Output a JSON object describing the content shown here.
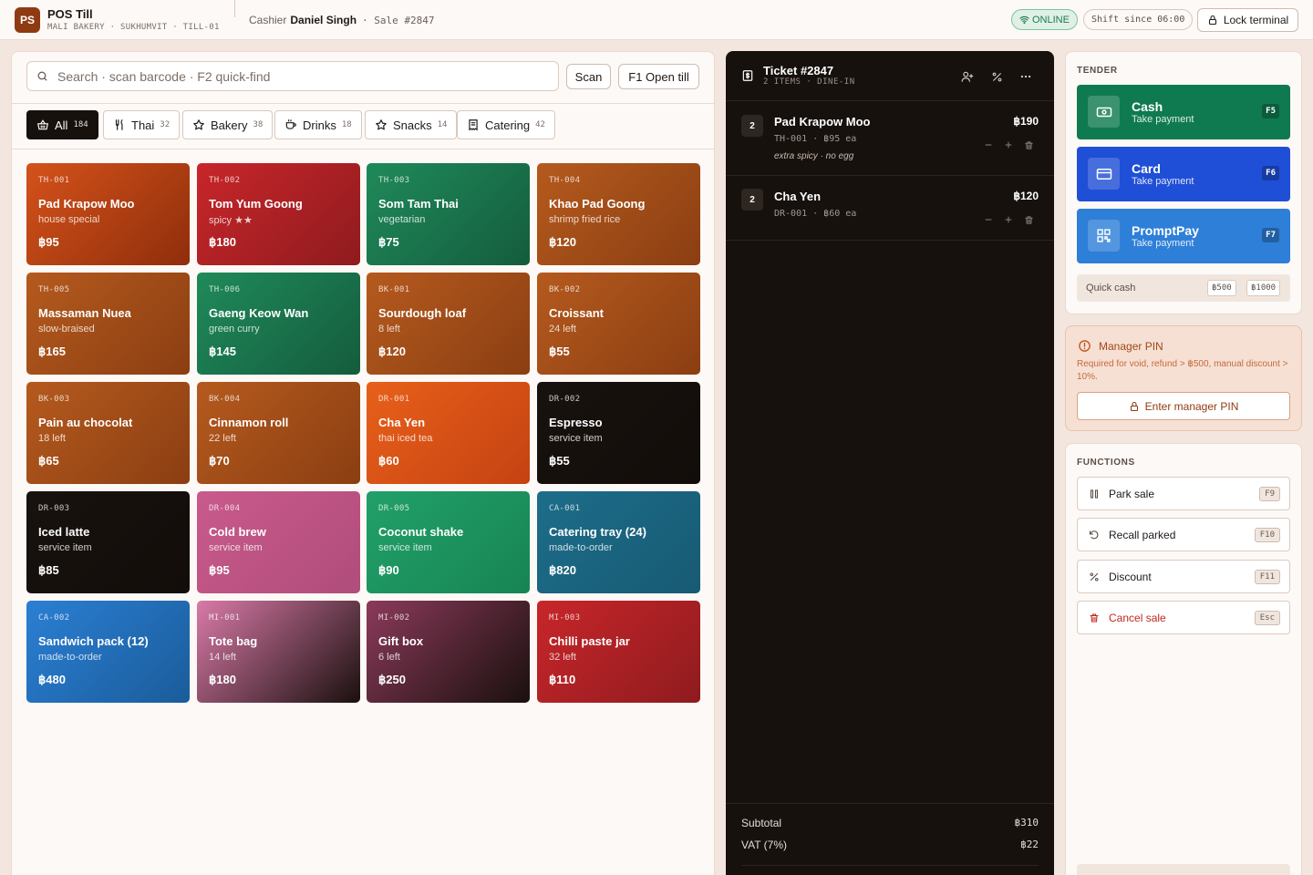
{
  "header": {
    "logo": "PS",
    "title": "POS Till",
    "subtitle": "MALI BAKERY · SUKHUMVIT · TILL-01",
    "cashier_label": "Cashier",
    "cashier_name": "Daniel Singh",
    "sale": "· Sale #2847",
    "status": "ONLINE",
    "shift": "Shift since 06:00",
    "lock_label": "Lock terminal"
  },
  "search": {
    "placeholder": "Search · scan barcode · F2 quick-find",
    "value": "",
    "scan_label": "Scan",
    "open_till_label": "F1 Open till"
  },
  "categories": [
    {
      "label": "All",
      "count": "184",
      "icon": "basket-icon",
      "active": true
    },
    {
      "label": "Thai",
      "count": "32",
      "icon": "utensils-icon"
    },
    {
      "label": "Bakery",
      "count": "38",
      "icon": "star-icon"
    },
    {
      "label": "Drinks",
      "count": "18",
      "icon": "cup-icon"
    },
    {
      "label": "Snacks",
      "count": "14",
      "icon": "star-icon"
    },
    {
      "label": "Catering",
      "count": "42",
      "icon": "receipt-icon"
    }
  ],
  "products": [
    {
      "sku": "TH-001",
      "name": "Pad Krapow Moo",
      "sub": "house special",
      "price": "฿95",
      "colors": [
        "#d4521a",
        "#8f2e0c"
      ]
    },
    {
      "sku": "TH-002",
      "name": "Tom Yum Goong",
      "sub": "spicy ★★",
      "price": "฿180",
      "colors": [
        "#c8262a",
        "#8e1b1e"
      ]
    },
    {
      "sku": "TH-003",
      "name": "Som Tam Thai",
      "sub": "vegetarian",
      "price": "฿75",
      "colors": [
        "#1f8a5a",
        "#145c3d"
      ]
    },
    {
      "sku": "TH-004",
      "name": "Khao Pad Goong",
      "sub": "shrimp fried rice",
      "price": "฿120",
      "colors": [
        "#b55a1e",
        "#8b3e12"
      ]
    },
    {
      "sku": "TH-005",
      "name": "Massaman Nuea",
      "sub": "slow-braised",
      "price": "฿165",
      "colors": [
        "#b55a1e",
        "#8b3e12"
      ]
    },
    {
      "sku": "TH-006",
      "name": "Gaeng Keow Wan",
      "sub": "green curry",
      "price": "฿145",
      "colors": [
        "#1f8a5a",
        "#145c3d"
      ]
    },
    {
      "sku": "BK-001",
      "name": "Sourdough loaf",
      "sub": "8 left",
      "price": "฿120",
      "colors": [
        "#b55a1e",
        "#8b3e12"
      ]
    },
    {
      "sku": "BK-002",
      "name": "Croissant",
      "sub": "24 left",
      "price": "฿55",
      "colors": [
        "#b55a1e",
        "#8b3e12"
      ]
    },
    {
      "sku": "BK-003",
      "name": "Pain au chocolat",
      "sub": "18 left",
      "price": "฿65",
      "colors": [
        "#b55a1e",
        "#8b3e12"
      ]
    },
    {
      "sku": "BK-004",
      "name": "Cinnamon roll",
      "sub": "22 left",
      "price": "฿70",
      "colors": [
        "#b55a1e",
        "#8b3e12"
      ]
    },
    {
      "sku": "DR-001",
      "name": "Cha Yen",
      "sub": "thai iced tea",
      "price": "฿60",
      "colors": [
        "#e8601a",
        "#c54212"
      ]
    },
    {
      "sku": "DR-002",
      "name": "Espresso",
      "sub": "service item",
      "price": "฿55",
      "colors": [
        "#18120e",
        "#120d0a"
      ]
    },
    {
      "sku": "DR-003",
      "name": "Iced latte",
      "sub": "service item",
      "price": "฿85",
      "colors": [
        "#18120e",
        "#120d0a"
      ]
    },
    {
      "sku": "DR-004",
      "name": "Cold brew",
      "sub": "service item",
      "price": "฿95",
      "colors": [
        "#c95a8c",
        "#b04d7a"
      ]
    },
    {
      "sku": "DR-005",
      "name": "Coconut shake",
      "sub": "service item",
      "price": "฿90",
      "colors": [
        "#22a06a",
        "#178553"
      ]
    },
    {
      "sku": "CA-001",
      "name": "Catering tray (24)",
      "sub": "made-to-order",
      "price": "฿820",
      "colors": [
        "#1d6d8a",
        "#175a73"
      ]
    },
    {
      "sku": "CA-002",
      "name": "Sandwich pack (12)",
      "sub": "made-to-order",
      "price": "฿480",
      "colors": [
        "#2b7fd4",
        "#1a5c9a"
      ]
    },
    {
      "sku": "MI-001",
      "name": "Tote bag",
      "sub": "14 left",
      "price": "฿180",
      "colors": [
        "#d97aa8",
        "#1a100e"
      ]
    },
    {
      "sku": "MI-002",
      "name": "Gift box",
      "sub": "6 left",
      "price": "฿250",
      "colors": [
        "#8b3a5a",
        "#1a100e"
      ]
    },
    {
      "sku": "MI-003",
      "name": "Chilli paste jar",
      "sub": "32 left",
      "price": "฿110",
      "colors": [
        "#c8262a",
        "#8e1b1e"
      ]
    }
  ],
  "ticket": {
    "title": "Ticket #2847",
    "subtitle": "2 ITEMS · DINE-IN",
    "lines": [
      {
        "qty": "2",
        "name": "Pad Krapow Moo",
        "meta": "TH-001  ·  ฿95 ea",
        "note": "extra spicy · no egg",
        "total": "฿190"
      },
      {
        "qty": "2",
        "name": "Cha Yen",
        "meta": "DR-001  ·  ฿60 ea",
        "note": "",
        "total": "฿120"
      }
    ],
    "subtotal_label": "Subtotal",
    "subtotal": "฿310",
    "vat_label": "VAT (7%)",
    "vat": "฿22"
  },
  "tender": {
    "label": "TENDER",
    "buttons": [
      {
        "title": "Cash",
        "sub": "Take payment",
        "key": "F5",
        "color": "#0f7a50",
        "icon": "cash-icon"
      },
      {
        "title": "Card",
        "sub": "Take payment",
        "key": "F6",
        "color": "#1f4fd6",
        "icon": "card-icon"
      },
      {
        "title": "PromptPay",
        "sub": "Take payment",
        "key": "F7",
        "color": "#2e7fd8",
        "icon": "qr-icon"
      }
    ],
    "quick_cash_label": "Quick cash",
    "quick_cash": [
      "฿500",
      "฿1000"
    ]
  },
  "manager": {
    "title": "Manager PIN",
    "desc": "Required for void, refund > ฿500, manual discount > 10%.",
    "button": "Enter manager PIN"
  },
  "functions": {
    "label": "FUNCTIONS",
    "items": [
      {
        "label": "Park sale",
        "key": "F9",
        "icon": "pause-icon"
      },
      {
        "label": "Recall parked",
        "key": "F10",
        "icon": "rotate-ccw-icon"
      },
      {
        "label": "Discount",
        "key": "F11",
        "icon": "percent-icon"
      },
      {
        "label": "Cancel sale",
        "key": "Esc",
        "icon": "trash-icon",
        "danger": true
      }
    ]
  }
}
